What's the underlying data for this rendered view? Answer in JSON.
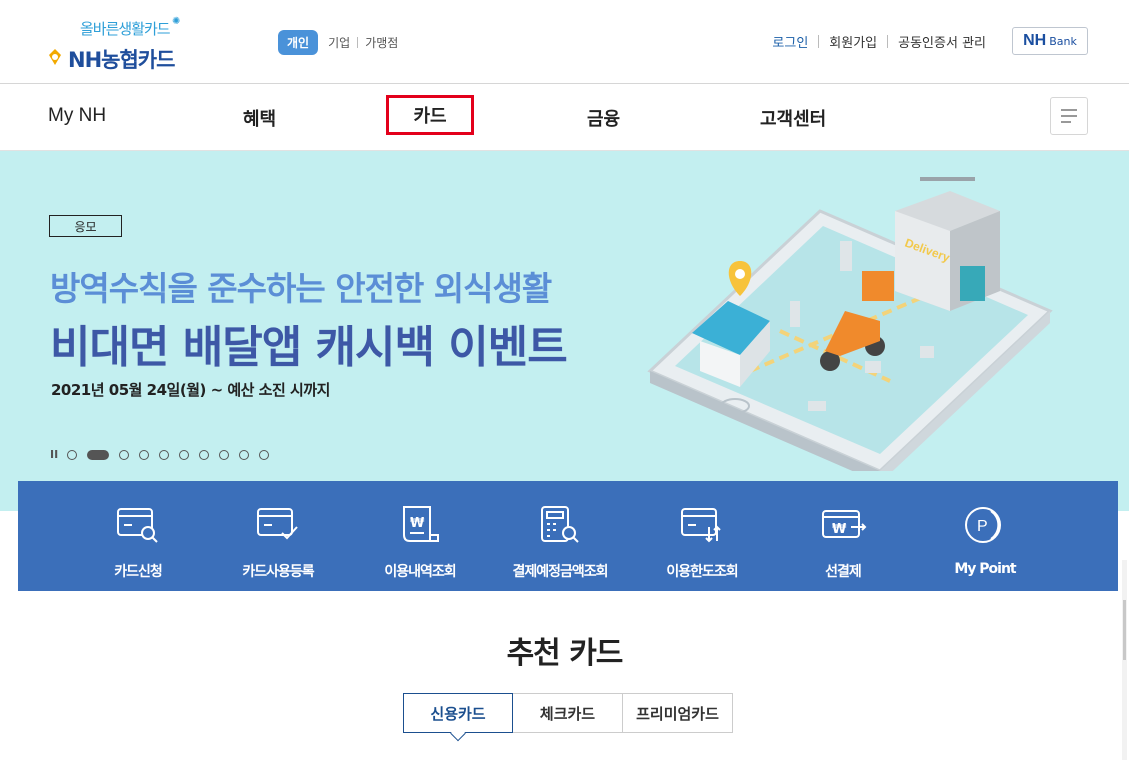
{
  "logo": {
    "slogan": "올바른생활카드",
    "name": "NH농협카드"
  },
  "segment": {
    "active": "개인",
    "items": [
      "기업",
      "가맹점"
    ]
  },
  "util": {
    "login": "로그인",
    "join": "회원가입",
    "cert": "공동인증서 관리",
    "bank_nh": "NH",
    "bank_label": "Bank"
  },
  "gnb": {
    "items": [
      "My NH",
      "혜택",
      "카드",
      "금융",
      "고객센터"
    ],
    "highlighted": "카드"
  },
  "banner": {
    "tag": "응모",
    "headline1": "방역수칙을 준수하는 안전한 외식생활",
    "headline2": "비대면 배달앱 캐시백 이벤트",
    "period": "2021년 05월 24일(월) ~ 예산 소진 시까지",
    "pause": "II",
    "slide_count": 10,
    "active_slide": 1,
    "illustration_text": "Delivery",
    "bg_color": "#c3eff0"
  },
  "quick_menu": {
    "bg_color": "#3b6fba",
    "items": [
      {
        "label": "카드신청",
        "icon": "card-search-icon"
      },
      {
        "label": "카드사용등록",
        "icon": "card-check-icon"
      },
      {
        "label": "이용내역조회",
        "icon": "won-document-icon"
      },
      {
        "label": "결제예정금액조회",
        "icon": "calculator-search-icon"
      },
      {
        "label": "이용한도조회",
        "icon": "card-arrows-icon"
      },
      {
        "label": "선결제",
        "icon": "won-card-arrow-icon"
      },
      {
        "label": "My Point",
        "icon": "point-coin-icon"
      }
    ]
  },
  "recommend": {
    "title": "추천 카드",
    "tabs": [
      "신용카드",
      "체크카드",
      "프리미엄카드"
    ],
    "active_tab": "신용카드"
  },
  "colors": {
    "brand_blue": "#1b4fa0",
    "highlight_red": "#e3001b",
    "accent_blue": "#4a92d9"
  }
}
